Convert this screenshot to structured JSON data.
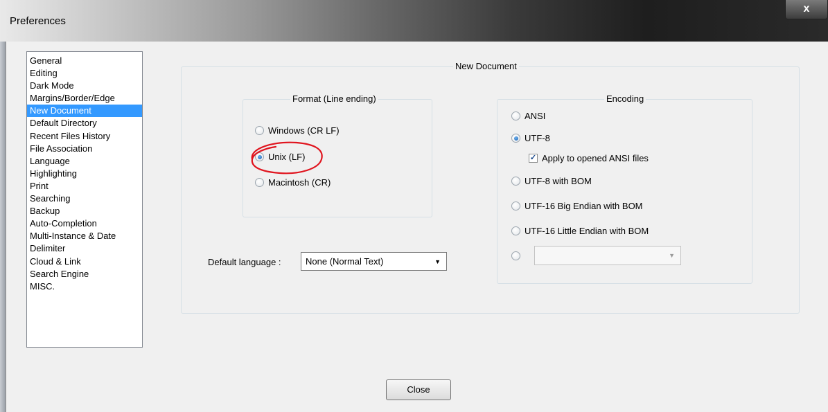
{
  "window": {
    "title": "Preferences",
    "close_glyph": "x"
  },
  "sidebar": {
    "items": [
      {
        "label": "General"
      },
      {
        "label": "Editing"
      },
      {
        "label": "Dark Mode"
      },
      {
        "label": "Margins/Border/Edge"
      },
      {
        "label": "New Document",
        "selected": true
      },
      {
        "label": "Default Directory"
      },
      {
        "label": "Recent Files History"
      },
      {
        "label": "File Association"
      },
      {
        "label": "Language"
      },
      {
        "label": "Highlighting"
      },
      {
        "label": "Print"
      },
      {
        "label": "Searching"
      },
      {
        "label": "Backup"
      },
      {
        "label": "Auto-Completion"
      },
      {
        "label": "Multi-Instance & Date"
      },
      {
        "label": "Delimiter"
      },
      {
        "label": "Cloud & Link"
      },
      {
        "label": "Search Engine"
      },
      {
        "label": "MISC."
      }
    ]
  },
  "new_document": {
    "group_title": "New Document",
    "format": {
      "title": "Format (Line ending)",
      "options": [
        {
          "label": "Windows (CR LF)",
          "checked": false
        },
        {
          "label": "Unix (LF)",
          "checked": true
        },
        {
          "label": "Macintosh (CR)",
          "checked": false
        }
      ]
    },
    "encoding": {
      "title": "Encoding",
      "options": [
        {
          "label": "ANSI",
          "checked": false
        },
        {
          "label": "UTF-8",
          "checked": true
        },
        {
          "label": "UTF-8 with BOM",
          "checked": false
        },
        {
          "label": "UTF-16 Big Endian with BOM",
          "checked": false
        },
        {
          "label": "UTF-16 Little Endian with BOM",
          "checked": false
        }
      ],
      "apply_ansi_label": "Apply to opened ANSI files",
      "apply_ansi_checked": true,
      "other_value": ""
    },
    "default_language": {
      "label": "Default language :",
      "value": "None (Normal Text)"
    }
  },
  "footer": {
    "close_label": "Close"
  },
  "colors": {
    "selection": "#3399ff",
    "annotation": "#e0141e"
  }
}
